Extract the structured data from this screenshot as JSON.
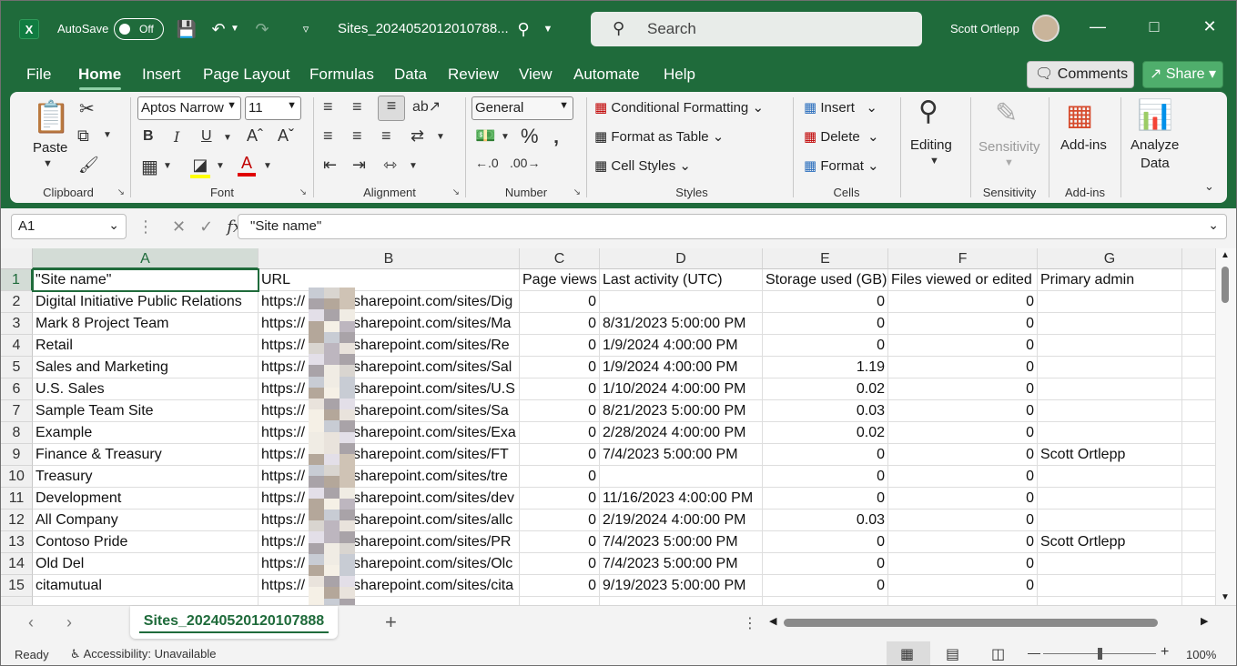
{
  "titlebar": {
    "app_badge": "X",
    "autosave_label": "AutoSave",
    "autosave_state": "Off",
    "filename": "Sites_2024052012010788...",
    "search_placeholder": "Search",
    "user_name": "Scott Ortlepp"
  },
  "tabs": [
    "File",
    "Home",
    "Insert",
    "Page Layout",
    "Formulas",
    "Data",
    "Review",
    "View",
    "Automate",
    "Help"
  ],
  "active_tab": "Home",
  "buttons": {
    "comments": "Comments",
    "share": "Share"
  },
  "ribbon": {
    "clipboard": {
      "label": "Clipboard",
      "paste": "Paste"
    },
    "font": {
      "label": "Font",
      "font_name": "Aptos Narrow",
      "font_size": "11"
    },
    "alignment": {
      "label": "Alignment"
    },
    "number": {
      "label": "Number",
      "format": "General"
    },
    "styles": {
      "label": "Styles",
      "conditional": "Conditional Formatting",
      "format_table": "Format as Table",
      "cell_styles": "Cell Styles"
    },
    "cells": {
      "label": "Cells",
      "insert": "Insert",
      "delete": "Delete",
      "format": "Format"
    },
    "editing": {
      "label": "Editing"
    },
    "sensitivity": {
      "label": "Sensitivity",
      "button": "Sensitivity"
    },
    "addins": {
      "label": "Add-ins",
      "button": "Add-ins"
    },
    "analyze": {
      "button_line1": "Analyze",
      "button_line2": "Data"
    }
  },
  "formula_bar": {
    "name_box": "A1",
    "formula": "\"Site name\""
  },
  "columns": [
    "A",
    "B",
    "C",
    "D",
    "E",
    "F",
    "G"
  ],
  "rows": [
    {
      "n": "1",
      "a": "\"Site name\"",
      "b": "URL",
      "c": "Page views",
      "d": "Last activity (UTC)",
      "e": "Storage used (GB)",
      "f": "Files viewed or edited",
      "g": "Primary admin"
    },
    {
      "n": "2",
      "a": "Digital Initiative Public Relations",
      "b": "https://",
      "bs": "sharepoint.com/sites/Dig",
      "c": "0",
      "d": "",
      "e": "0",
      "f": "0",
      "g": ""
    },
    {
      "n": "3",
      "a": "Mark 8 Project Team",
      "b": "https://",
      "bs": "sharepoint.com/sites/Ma",
      "c": "0",
      "d": "8/31/2023 5:00:00 PM",
      "e": "0",
      "f": "0",
      "g": ""
    },
    {
      "n": "4",
      "a": "Retail",
      "b": "https://",
      "bs": "sharepoint.com/sites/Re",
      "c": "0",
      "d": "1/9/2024 4:00:00 PM",
      "e": "0",
      "f": "0",
      "g": ""
    },
    {
      "n": "5",
      "a": "Sales and Marketing",
      "b": "https://",
      "bs": "sharepoint.com/sites/Sal",
      "c": "0",
      "d": "1/9/2024 4:00:00 PM",
      "e": "1.19",
      "f": "0",
      "g": ""
    },
    {
      "n": "6",
      "a": "U.S. Sales",
      "b": "https://",
      "bs": "sharepoint.com/sites/U.S",
      "c": "0",
      "d": "1/10/2024 4:00:00 PM",
      "e": "0.02",
      "f": "0",
      "g": ""
    },
    {
      "n": "7",
      "a": "Sample Team Site",
      "b": "https://",
      "bs": "sharepoint.com/sites/Sa",
      "c": "0",
      "d": "8/21/2023 5:00:00 PM",
      "e": "0.03",
      "f": "0",
      "g": ""
    },
    {
      "n": "8",
      "a": "Example",
      "b": "https://",
      "bs": "sharepoint.com/sites/Exa",
      "c": "0",
      "d": "2/28/2024 4:00:00 PM",
      "e": "0.02",
      "f": "0",
      "g": ""
    },
    {
      "n": "9",
      "a": "Finance & Treasury",
      "b": "https://",
      "bs": "sharepoint.com/sites/FT",
      "c": "0",
      "d": "7/4/2023 5:00:00 PM",
      "e": "0",
      "f": "0",
      "g": "Scott Ortlepp"
    },
    {
      "n": "10",
      "a": "Treasury",
      "b": "https://",
      "bs": "sharepoint.com/sites/tre",
      "c": "0",
      "d": "",
      "e": "0",
      "f": "0",
      "g": ""
    },
    {
      "n": "11",
      "a": "Development",
      "b": "https://",
      "bs": "sharepoint.com/sites/dev",
      "c": "0",
      "d": "11/16/2023 4:00:00 PM",
      "e": "0",
      "f": "0",
      "g": ""
    },
    {
      "n": "12",
      "a": "All Company",
      "b": "https://",
      "bs": "sharepoint.com/sites/allc",
      "c": "0",
      "d": "2/19/2024 4:00:00 PM",
      "e": "0.03",
      "f": "0",
      "g": ""
    },
    {
      "n": "13",
      "a": "Contoso Pride",
      "b": "https://",
      "bs": "sharepoint.com/sites/PR",
      "c": "0",
      "d": "7/4/2023 5:00:00 PM",
      "e": "0",
      "f": "0",
      "g": "Scott Ortlepp"
    },
    {
      "n": "14",
      "a": "Old Del",
      "b": "https://",
      "bs": "sharepoint.com/sites/Olc",
      "c": "0",
      "d": "7/4/2023 5:00:00 PM",
      "e": "0",
      "f": "0",
      "g": ""
    },
    {
      "n": "15",
      "a": "citamutual",
      "b": "https://",
      "bs": "sharepoint.com/sites/cita",
      "c": "0",
      "d": "9/19/2023 5:00:00 PM",
      "e": "0",
      "f": "0",
      "g": ""
    }
  ],
  "sheet_tab": "Sites_20240520120107888",
  "status": {
    "ready": "Ready",
    "accessibility": "Accessibility: Unavailable",
    "zoom": "100%"
  }
}
